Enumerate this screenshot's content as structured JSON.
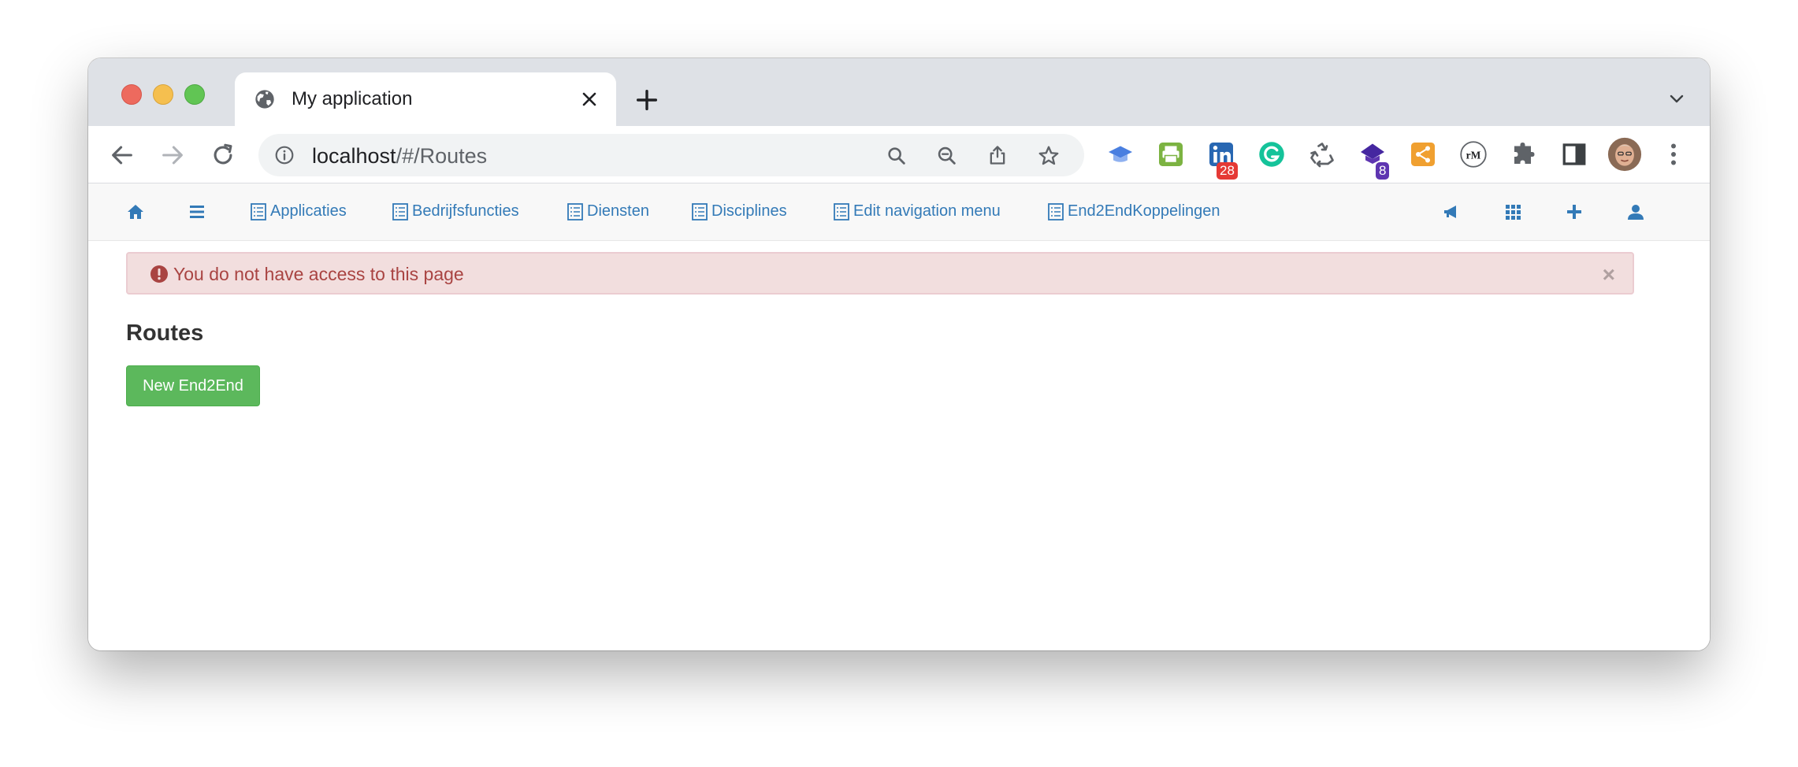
{
  "browser": {
    "tab_title": "My application",
    "url_host": "localhost",
    "url_path": "/#/Routes",
    "extension_badges": {
      "linkedin": "28",
      "purple": "8"
    }
  },
  "navbar": {
    "links": [
      {
        "label": "Applicaties"
      },
      {
        "label": "Bedrijfsfuncties"
      },
      {
        "label": "Diensten"
      },
      {
        "label": "Disciplines"
      },
      {
        "label": "Edit navigation menu"
      },
      {
        "label": "End2EndKoppelingen"
      }
    ],
    "link_color": "#337ab7"
  },
  "alert": {
    "message": "You do not have access to this page",
    "close_symbol": "×"
  },
  "main": {
    "title": "Routes",
    "new_button_label": "New End2End"
  }
}
